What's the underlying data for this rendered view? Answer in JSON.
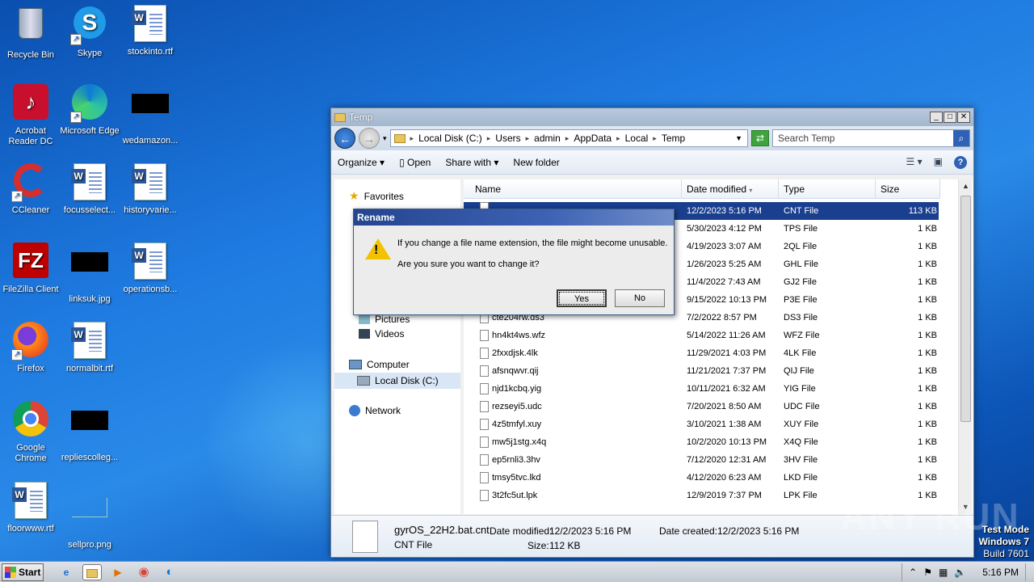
{
  "desktop": {
    "icons": [
      {
        "label": "Recycle Bin"
      },
      {
        "label": "Skype"
      },
      {
        "label": "stockinto.rtf"
      },
      {
        "label": "Acrobat Reader DC"
      },
      {
        "label": "Microsoft Edge"
      },
      {
        "label": "wedamazon..."
      },
      {
        "label": "CCleaner"
      },
      {
        "label": "focusselect..."
      },
      {
        "label": "historyvarie..."
      },
      {
        "label": "FileZilla Client"
      },
      {
        "label": "linksuk.jpg"
      },
      {
        "label": "operationsb..."
      },
      {
        "label": "Firefox"
      },
      {
        "label": "normalbit.rtf"
      },
      {
        "label": "Google Chrome"
      },
      {
        "label": "repliescolleg..."
      },
      {
        "label": "floorwww.rtf"
      },
      {
        "label": "sellpro.png"
      }
    ]
  },
  "explorer": {
    "title": "Temp",
    "breadcrumbs": [
      "Local Disk (C:)",
      "Users",
      "admin",
      "AppData",
      "Local",
      "Temp"
    ],
    "search_placeholder": "Search Temp",
    "commands": {
      "organize": "Organize",
      "open": "Open",
      "share": "Share with",
      "new_folder": "New folder"
    },
    "nav": {
      "favorites": "Favorites",
      "pictures": "Pictures",
      "videos": "Videos",
      "computer": "Computer",
      "local_disk": "Local Disk (C:)",
      "network": "Network"
    },
    "columns": {
      "name": "Name",
      "date": "Date modified",
      "type": "Type",
      "size": "Size"
    },
    "files": [
      {
        "name": "",
        "date": "12/2/2023 5:16 PM",
        "type": "CNT File",
        "size": "113 KB"
      },
      {
        "name": "",
        "date": "5/30/2023 4:12 PM",
        "type": "TPS File",
        "size": "1 KB"
      },
      {
        "name": "",
        "date": "4/19/2023 3:07 AM",
        "type": "2QL File",
        "size": "1 KB"
      },
      {
        "name": "",
        "date": "1/26/2023 5:25 AM",
        "type": "GHL File",
        "size": "1 KB"
      },
      {
        "name": "",
        "date": "11/4/2022 7:43 AM",
        "type": "GJ2 File",
        "size": "1 KB"
      },
      {
        "name": "",
        "date": "9/15/2022 10:13 PM",
        "type": "P3E File",
        "size": "1 KB"
      },
      {
        "name": "cte204rw.ds3",
        "date": "7/2/2022 8:57 PM",
        "type": "DS3 File",
        "size": "1 KB"
      },
      {
        "name": "hn4kt4ws.wfz",
        "date": "5/14/2022 11:26 AM",
        "type": "WFZ File",
        "size": "1 KB"
      },
      {
        "name": "2fxxdjsk.4lk",
        "date": "11/29/2021 4:03 PM",
        "type": "4LK File",
        "size": "1 KB"
      },
      {
        "name": "afsnqwvr.qij",
        "date": "11/21/2021 7:37 PM",
        "type": "QIJ File",
        "size": "1 KB"
      },
      {
        "name": "njd1kcbq.yig",
        "date": "10/11/2021 6:32 AM",
        "type": "YIG File",
        "size": "1 KB"
      },
      {
        "name": "rezseyi5.udc",
        "date": "7/20/2021 8:50 AM",
        "type": "UDC File",
        "size": "1 KB"
      },
      {
        "name": "4z5tmfyl.xuy",
        "date": "3/10/2021 1:38 AM",
        "type": "XUY File",
        "size": "1 KB"
      },
      {
        "name": "mw5j1stg.x4q",
        "date": "10/2/2020 10:13 PM",
        "type": "X4Q File",
        "size": "1 KB"
      },
      {
        "name": "ep5rnli3.3hv",
        "date": "7/12/2020 12:31 AM",
        "type": "3HV File",
        "size": "1 KB"
      },
      {
        "name": "tmsy5tvc.lkd",
        "date": "4/12/2020 6:23 AM",
        "type": "LKD File",
        "size": "1 KB"
      },
      {
        "name": "3t2fc5ut.lpk",
        "date": "12/9/2019 7:37 PM",
        "type": "LPK File",
        "size": "1 KB"
      }
    ],
    "details": {
      "filename": "gyrOS_22H2.bat.cnt",
      "filetype": "CNT File",
      "date_modified_label": "Date modified:",
      "date_modified": "12/2/2023 5:16 PM",
      "date_created_label": "Date created:",
      "date_created": "12/2/2023 5:16 PM",
      "size_label": "Size:",
      "size": "112 KB"
    }
  },
  "dialog": {
    "title": "Rename",
    "line1": "If you change a file name extension, the file might become unusable.",
    "line2": "Are you sure you want to change it?",
    "yes": "Yes",
    "no": "No"
  },
  "taskbar": {
    "start": "Start",
    "clock": "5:16 PM"
  },
  "watermark": "ANY RUN",
  "testmode": {
    "line1": "Test Mode",
    "line2": "Windows 7",
    "line3": "Build 7601"
  },
  "colors": {
    "selection": "#1a3f8f",
    "dialog_title": "#24458f",
    "warning": "#f2c200"
  }
}
